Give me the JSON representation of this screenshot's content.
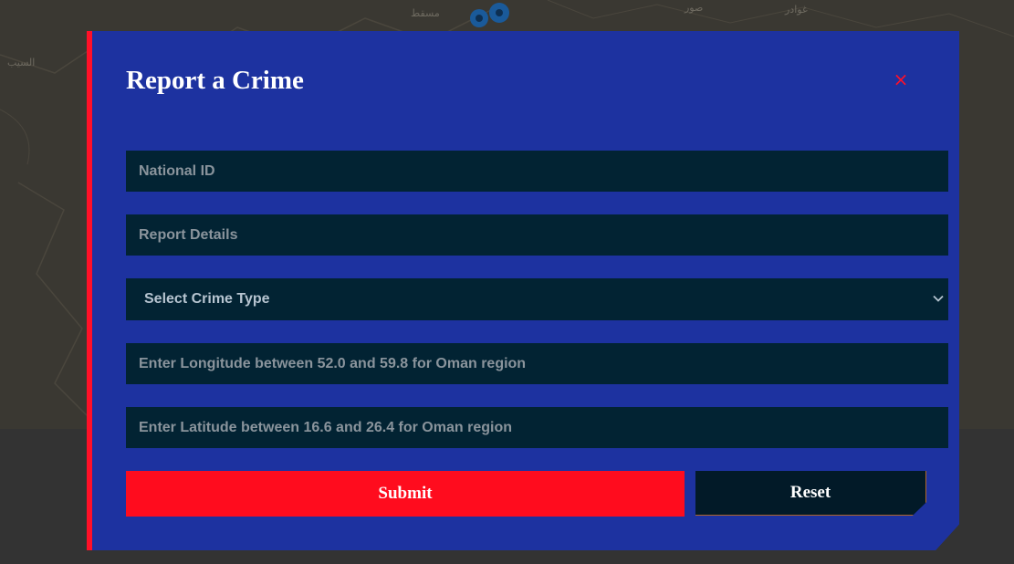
{
  "map": {
    "labels": [
      "ﻣﺴﻘﻂ",
      "ﺻﻮﺭ",
      "ﻏﻮﺍﺩﺭ",
      "ﺍﻟﺴﻴﺐ"
    ]
  },
  "modal": {
    "title": "Report a Crime",
    "close_symbol": "×",
    "fields": {
      "national_id_placeholder": "National ID",
      "report_details_placeholder": "Report Details",
      "crime_type_selected": "Select Crime Type",
      "longitude_placeholder": "Enter Longitude between 52.0 and 59.8 for Oman region",
      "latitude_placeholder": "Enter Latitude between 16.6 and 26.4 for Oman region"
    },
    "buttons": {
      "submit_label": "Submit",
      "reset_label": "Reset"
    }
  },
  "colors": {
    "modal_bg": "#1d32a0",
    "accent": "#ff1028",
    "field_bg": "#022333"
  },
  "icons": {
    "close": "close-icon",
    "dropdown": "chevron-down-icon",
    "marker": "map-marker-icon"
  }
}
